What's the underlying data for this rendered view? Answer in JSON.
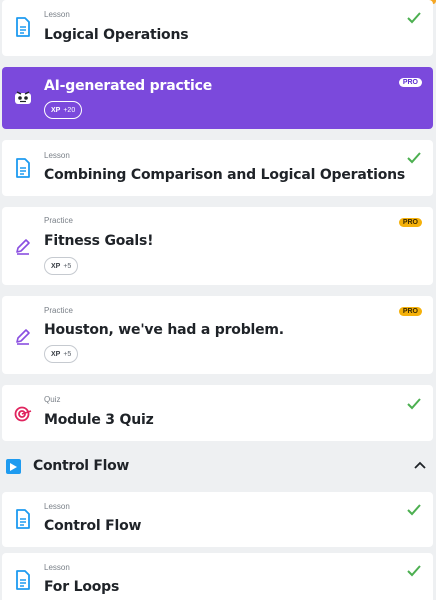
{
  "items": [
    {
      "type": "Lesson",
      "title": "Logical Operations",
      "completed": true
    },
    {
      "type": "",
      "title": "AI-generated practice",
      "badge": "PRO",
      "xp_label": "XP",
      "xp_value": "+20"
    },
    {
      "type": "Lesson",
      "title": "Combining Comparison and Logical Operations",
      "completed": true
    },
    {
      "type": "Practice",
      "title": "Fitness Goals!",
      "badge": "PRO",
      "xp_label": "XP",
      "xp_value": "+5"
    },
    {
      "type": "Practice",
      "title": "Houston, we've had a problem.",
      "badge": "PRO",
      "xp_label": "XP",
      "xp_value": "+5"
    },
    {
      "type": "Quiz",
      "title": "Module 3 Quiz",
      "completed": true
    }
  ],
  "section": {
    "title": "Control Flow",
    "expanded": true
  },
  "section_items": [
    {
      "type": "Lesson",
      "title": "Control Flow",
      "completed": true
    },
    {
      "type": "Lesson",
      "title": "For Loops",
      "completed": true
    }
  ],
  "colors": {
    "accent_purple": "#7b49dc",
    "check_green": "#4caf50",
    "pro_gold": "#f5b10a",
    "lesson_blue": "#1e9bf0",
    "quiz_pink": "#e0245e"
  }
}
